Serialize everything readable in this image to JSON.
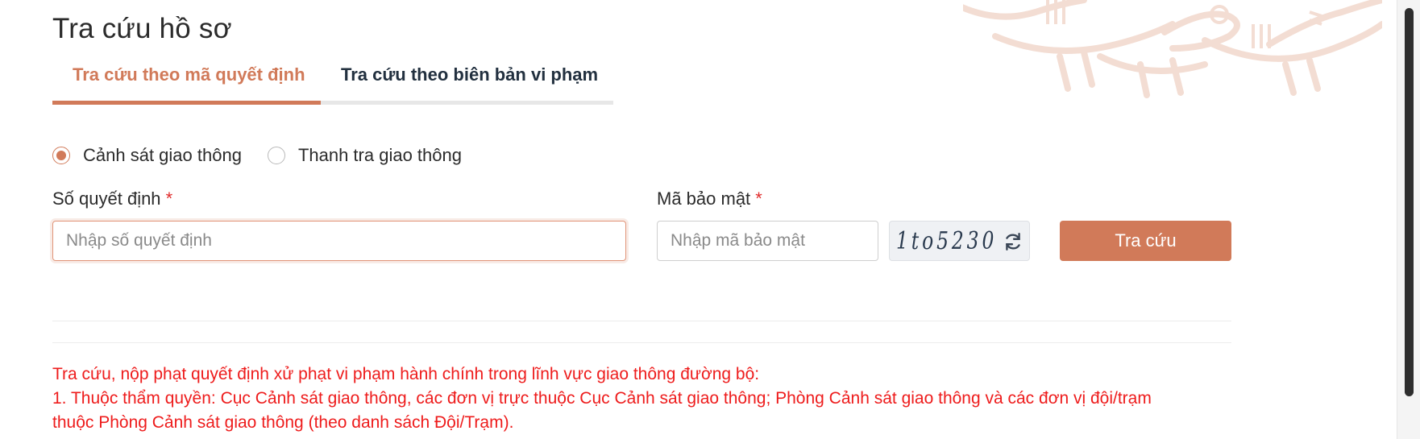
{
  "page": {
    "title": "Tra cứu hồ sơ"
  },
  "tabs": [
    {
      "label": "Tra cứu theo mã quyết định",
      "active": true
    },
    {
      "label": "Tra cứu theo biên bản vi phạm",
      "active": false
    }
  ],
  "agency": {
    "options": [
      "Cảnh sát giao thông",
      "Thanh tra giao thông"
    ],
    "selected": "Cảnh sát giao thông"
  },
  "form": {
    "decision_label": "Số quyết định",
    "decision_placeholder": "Nhập số quyết định",
    "decision_value": "",
    "security_label": "Mã bảo mật",
    "security_placeholder": "Nhập mã bảo mật",
    "security_value": "",
    "required_mark": "*",
    "captcha_text": "1to5230",
    "refresh_icon": "refresh-icon",
    "submit_label": "Tra cứu"
  },
  "notice": {
    "line1": "Tra cứu, nộp phạt quyết định xử phạt vi phạm hành chính trong lĩnh vực giao thông đường bộ:",
    "line2": "1. Thuộc thẩm quyền: Cục Cảnh sát giao thông, các đơn vị trực thuộc Cục Cảnh sát giao thông; Phòng Cảnh sát giao thông và các đơn vị đội/trạm",
    "line3": "thuộc Phòng Cảnh sát giao thông (theo danh sách Đội/Trạm)."
  },
  "colors": {
    "accent": "#d17a59",
    "notice": "#ee1c1c",
    "text": "#2b2b2b",
    "tab_inactive": "#22303f"
  }
}
